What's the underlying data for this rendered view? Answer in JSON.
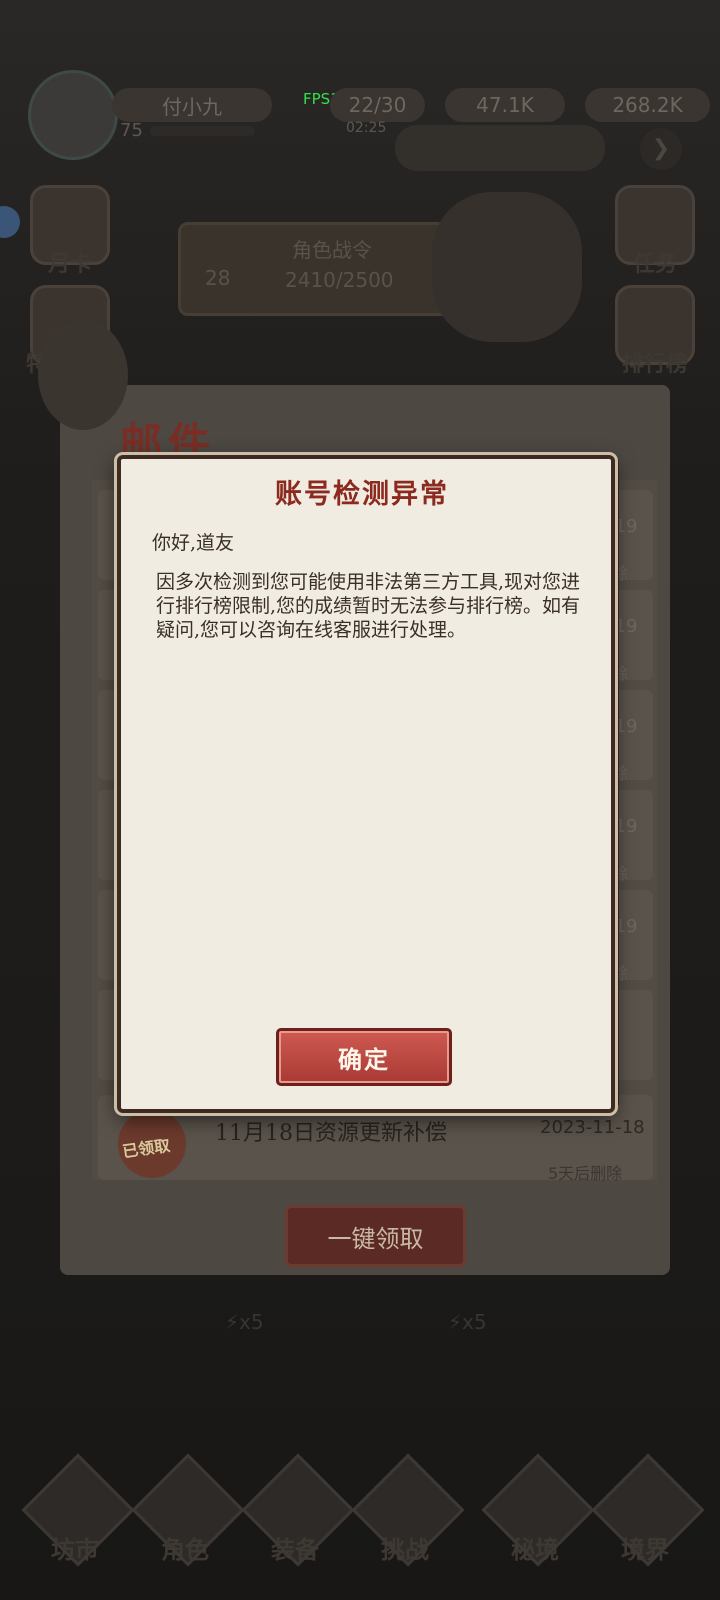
{
  "fps": "FPS120",
  "hud": {
    "player_name": "付小九",
    "level": "75",
    "energy": "22/30",
    "energy_timer": "02:25",
    "currency_1": "47.1K",
    "currency_2": "268.2K"
  },
  "side_left": [
    "月卡",
    "特惠礼包"
  ],
  "side_right": [
    "任务",
    "排行榜"
  ],
  "battle_pass": {
    "title": "角色战令",
    "level": "28",
    "progress": "2410/2500"
  },
  "mail": {
    "title": "邮件",
    "row_date_fragment": "-19",
    "row_delete_fragment": "除",
    "last_row": {
      "title": "11月18日资源更新补偿",
      "date": "2023-11-18",
      "delete_note": "5天后删除",
      "badge": "已领取"
    },
    "claim_all": "一键领取"
  },
  "dialog": {
    "title": "账号检测异常",
    "greeting": "你好,道友",
    "body": "因多次检测到您可能使用非法第三方工具,现对您进行排行榜限制,您的成绩暂时无法参与排行榜。如有疑问,您可以咨询在线客服进行处理。",
    "confirm": "确定"
  },
  "stamina_tags": [
    "⚡x5",
    "⚡x5"
  ],
  "bottom_nav": [
    "坊市",
    "角色",
    "装备",
    "挑战",
    "秘境",
    "境界"
  ],
  "colors": {
    "dialog_bg": "#f1ece2",
    "title_red": "#8c2a1f",
    "button_red": "#c44d45"
  }
}
